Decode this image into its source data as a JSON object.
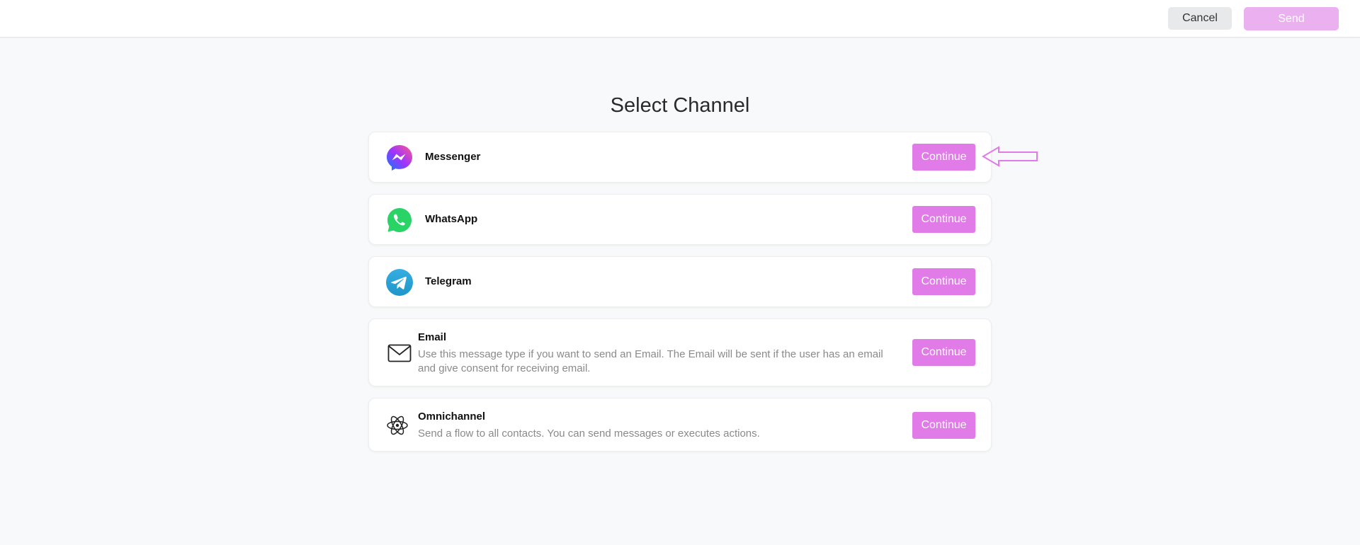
{
  "header": {
    "cancel_label": "Cancel",
    "send_label": "Send"
  },
  "page": {
    "title": "Select Channel"
  },
  "channels": [
    {
      "name": "Messenger",
      "description": "",
      "button": "Continue",
      "icon": "messenger-icon"
    },
    {
      "name": "WhatsApp",
      "description": "",
      "button": "Continue",
      "icon": "whatsapp-icon"
    },
    {
      "name": "Telegram",
      "description": "",
      "button": "Continue",
      "icon": "telegram-icon"
    },
    {
      "name": "Email",
      "description": "Use this message type if you want to send an Email. The Email will be sent if the user has an email and give consent for receiving email.",
      "button": "Continue",
      "icon": "envelope-icon"
    },
    {
      "name": "Omnichannel",
      "description": "Send a flow to all contacts. You can send messages or executes actions.",
      "button": "Continue",
      "icon": "atom-icon"
    }
  ],
  "annotation": {
    "icon": "arrow-left-icon",
    "color": "#e07be8"
  },
  "colors": {
    "accent": "#e07be8",
    "send_disabled": "#eab0ef",
    "background": "#f8f9fa"
  }
}
